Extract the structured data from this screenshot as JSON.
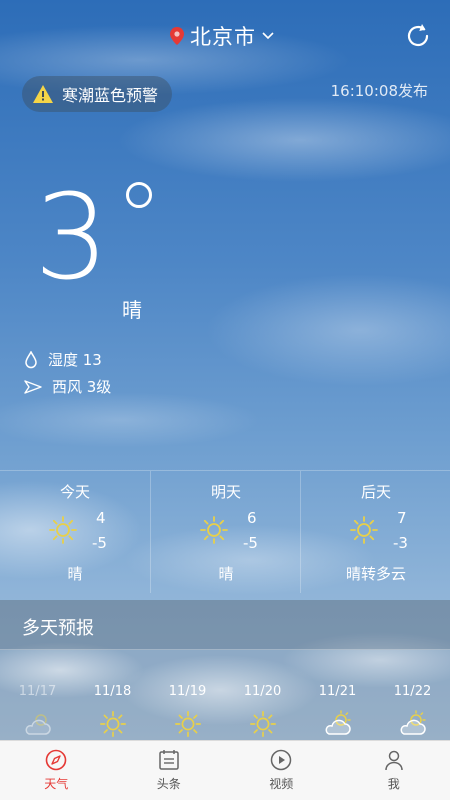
{
  "header": {
    "city": "北京市"
  },
  "alert": {
    "text": "寒潮蓝色预警"
  },
  "publish_time": "16:10:08发布",
  "current": {
    "temperature": "3",
    "condition": "晴",
    "humidity": "湿度 13",
    "wind": "西风 3级"
  },
  "three_day": [
    {
      "label": "今天",
      "high": "4",
      "low": "-5",
      "condition": "晴",
      "icon": "sun-icon"
    },
    {
      "label": "明天",
      "high": "6",
      "low": "-5",
      "condition": "晴",
      "icon": "sun-icon"
    },
    {
      "label": "后天",
      "high": "7",
      "low": "-3",
      "condition": "晴转多云",
      "icon": "sun-icon"
    }
  ],
  "forecast": {
    "title": "多天预报",
    "days": [
      {
        "date": "11/17",
        "icon": "partly-cloudy-icon"
      },
      {
        "date": "11/18",
        "icon": "sun-icon"
      },
      {
        "date": "11/19",
        "icon": "sun-icon"
      },
      {
        "date": "11/20",
        "icon": "sun-icon"
      },
      {
        "date": "11/21",
        "icon": "partly-cloudy-icon"
      },
      {
        "date": "11/22",
        "icon": "partly-cloudy-icon"
      }
    ]
  },
  "nav": [
    {
      "label": "天气",
      "icon": "compass-icon",
      "active": true
    },
    {
      "label": "头条",
      "icon": "news-icon"
    },
    {
      "label": "视频",
      "icon": "play-icon"
    },
    {
      "label": "我",
      "icon": "person-icon"
    }
  ],
  "colors": {
    "accent": "#e53935",
    "sun": "#e8d04a",
    "location_pin": "#e53935"
  }
}
